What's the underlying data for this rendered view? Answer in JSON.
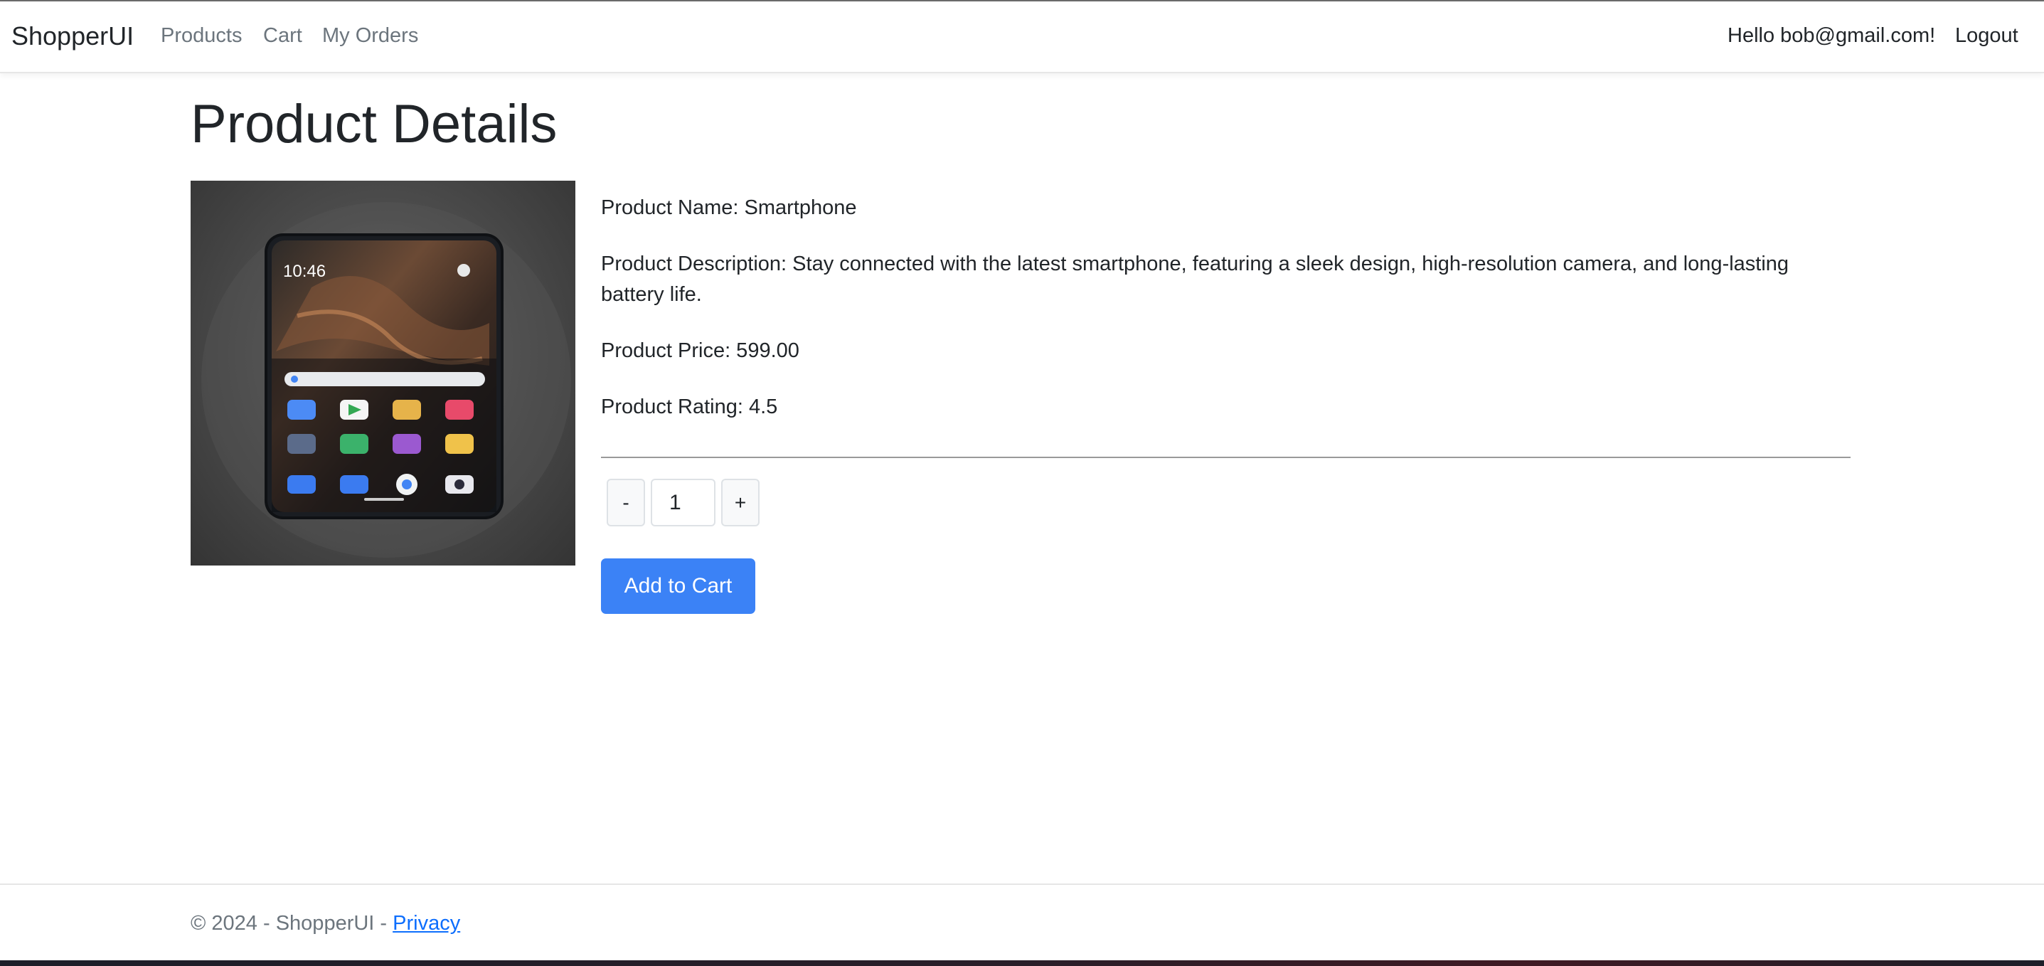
{
  "nav": {
    "brand": "ShopperUI",
    "links": [
      "Products",
      "Cart",
      "My Orders"
    ],
    "greeting": "Hello bob@gmail.com!",
    "logout": "Logout"
  },
  "page": {
    "title": "Product Details"
  },
  "product": {
    "name_line": "Product Name: Smartphone",
    "description_line": "Product Description: Stay connected with the latest smartphone, featuring a sleek design, high-resolution camera, and long-lasting battery life.",
    "price_line": "Product Price: 599.00",
    "rating_line": "Product Rating: 4.5",
    "image_icon": "smartphone-image",
    "phone_time": "10:46"
  },
  "cart_controls": {
    "decrement_label": "-",
    "quantity": "1",
    "increment_label": "+",
    "add_label": "Add to Cart",
    "add_color": "#3b82f6"
  },
  "footer": {
    "copyright": "© 2024 - ShopperUI - ",
    "privacy_label": "Privacy"
  }
}
